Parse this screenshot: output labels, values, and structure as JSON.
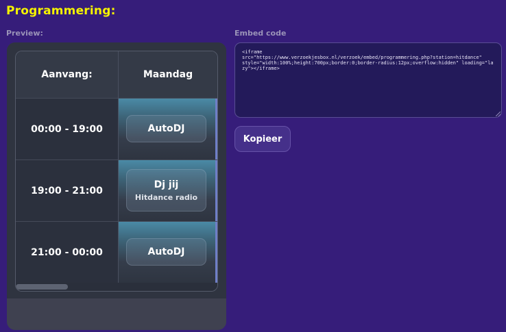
{
  "page": {
    "title": "Programmering:"
  },
  "preview": {
    "label": "Preview:",
    "table": {
      "col_time_header": "Aanvang:",
      "col_day_header": "Maandag",
      "rows": [
        {
          "time": "00:00 - 19:00",
          "show": "AutoDJ",
          "subtitle": ""
        },
        {
          "time": "19:00 - 21:00",
          "show": "Dj jij",
          "subtitle": "Hitdance radio"
        },
        {
          "time": "21:00 - 00:00",
          "show": "AutoDJ",
          "subtitle": ""
        }
      ]
    }
  },
  "embed": {
    "label": "Embed code",
    "code": "<iframe\nsrc=\"https://www.verzoekjesbox.nl/verzoek/embed/programmering.php?station=hitdance\"\nstyle=\"width:100%;height:700px;border:0;border-radius:12px;overflow:hidden\" loading=\"lazy\"></iframe>",
    "copy_label": "Kopieer"
  },
  "colors": {
    "background": "#361d7a",
    "title": "#f5f300",
    "panel": "#3f4150",
    "button": "#45308a"
  }
}
